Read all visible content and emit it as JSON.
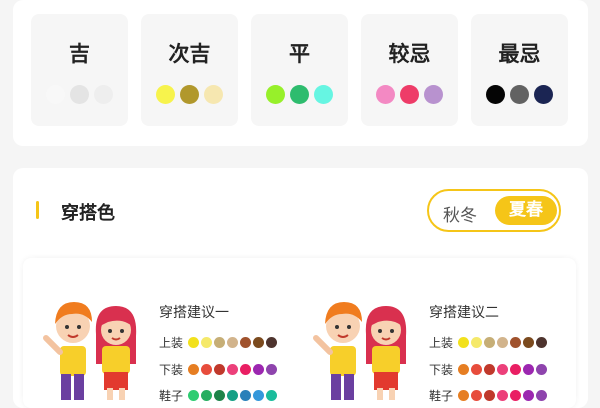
{
  "fortune": {
    "categories": [
      {
        "label": "吉",
        "colors": [
          "#f8f8f8",
          "#e4e4e4",
          "#eeeeee"
        ]
      },
      {
        "label": "次吉",
        "colors": [
          "#f7f34c",
          "#b1982c",
          "#f6e7b0"
        ]
      },
      {
        "label": "平",
        "colors": [
          "#97f02a",
          "#2ebc6e",
          "#66f5e2"
        ]
      },
      {
        "label": "较忌",
        "colors": [
          "#f389c3",
          "#ee3c68",
          "#b892cf"
        ]
      },
      {
        "label": "最忌",
        "colors": [
          "#050505",
          "#626262",
          "#1b2553"
        ]
      }
    ]
  },
  "outfit": {
    "section_title": "穿搭色",
    "season_toggle": {
      "option_a": "秋冬",
      "option_b": "夏春",
      "selected": "夏春"
    },
    "accent_color": "#f5c518",
    "suggestions": [
      {
        "title": "穿搭建议一",
        "rows": [
          {
            "label": "上装",
            "colors": [
              "#f2e11c",
              "#f5e96a",
              "#c6ae76",
              "#d2b48c",
              "#a0522d",
              "#7b4a1e",
              "#4e342e"
            ]
          },
          {
            "label": "下装",
            "colors": [
              "#e67e22",
              "#e74c3c",
              "#c0392b",
              "#ec407a",
              "#e91e63",
              "#9c27b0",
              "#8e44ad"
            ]
          },
          {
            "label": "鞋子",
            "colors": [
              "#2ecc71",
              "#27ae60",
              "#1e8449",
              "#16a085",
              "#2980b9",
              "#3498db",
              "#1abc9c"
            ]
          }
        ]
      },
      {
        "title": "穿搭建议二",
        "rows": [
          {
            "label": "上装",
            "colors": [
              "#f2e11c",
              "#f5e96a",
              "#c6ae76",
              "#d2b48c",
              "#a0522d",
              "#7b4a1e",
              "#4e342e"
            ]
          },
          {
            "label": "下装",
            "colors": [
              "#e67e22",
              "#e74c3c",
              "#c0392b",
              "#ec407a",
              "#e91e63",
              "#9c27b0",
              "#8e44ad"
            ]
          },
          {
            "label": "鞋子",
            "colors": [
              "#e67e22",
              "#e74c3c",
              "#c0392b",
              "#ec407a",
              "#e91e63",
              "#9c27b0",
              "#8e44ad"
            ]
          }
        ]
      }
    ]
  }
}
